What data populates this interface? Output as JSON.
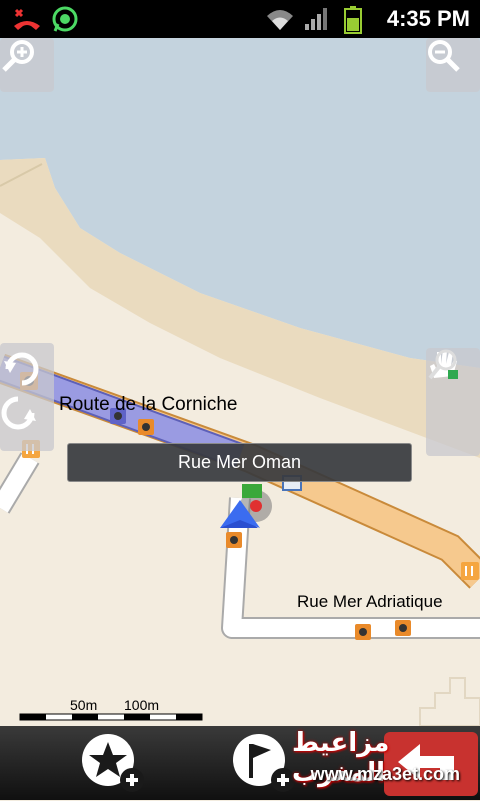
{
  "status_bar": {
    "time": "4:35 PM",
    "icons": [
      "missed-call-icon",
      "whatsapp-icon",
      "wifi-icon",
      "signal-icon",
      "battery-icon"
    ]
  },
  "map": {
    "road_labels": {
      "corniche": "Route de la Corniche",
      "adriatique": "Rue Mer Adriatique"
    },
    "current_street": "Rue Mer Oman",
    "scale": {
      "label_1": "50m",
      "label_2": "100m"
    }
  },
  "controls": {
    "zoom_in": "zoom-in-icon",
    "zoom_out": "zoom-out-icon",
    "rotate": "rotate-icon",
    "pan_lock": "hand-lock-icon",
    "zoom_lock": "magnifier-lock-icon"
  },
  "bottom_bar": {
    "favorites": "star-add-icon",
    "add_destination": "flag-add-icon",
    "back": "back-arrow-icon"
  },
  "watermark": {
    "arabic": "مزاعيط المغرب",
    "url": "www.mza3et.com"
  },
  "colors": {
    "sea": "#c4d3de",
    "land": "#f3ecdf",
    "beach": "#eadbbf",
    "road_main": "#f6c98e",
    "route": "#8e8fd8"
  }
}
